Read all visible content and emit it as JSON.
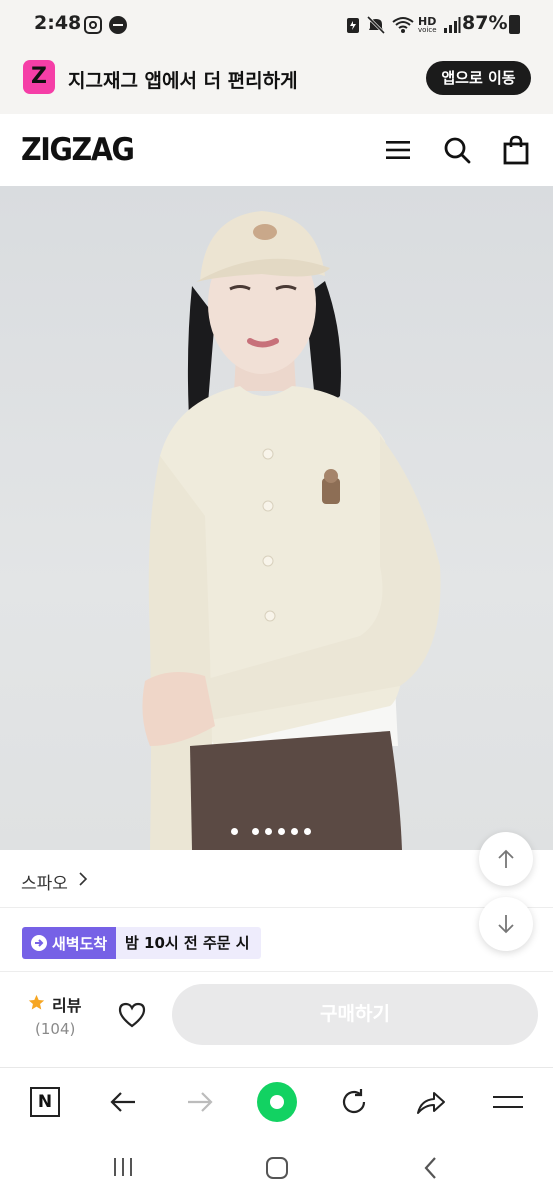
{
  "status_bar": {
    "time": "2:48",
    "network_label": "HD",
    "network_sublabel": "voice",
    "battery_percent": "87%"
  },
  "app_banner": {
    "logo_letter": "Z",
    "message": "지그재그 앱에서 더 편리하게",
    "open_app_button": "앱으로 이동"
  },
  "header": {
    "logo": "ZIGZAG",
    "icons": [
      "menu-icon",
      "search-icon",
      "shopping-bag-icon"
    ]
  },
  "product": {
    "image_count": 6,
    "current_image": 1,
    "brand": "스파오",
    "brand_aux": "°",
    "delivery_badge": "새벽도착",
    "delivery_note": "밤 10시 전 주문 시"
  },
  "action_bar": {
    "review_label": "리뷰",
    "review_count": "(104)",
    "buy_button": "구매하기"
  },
  "colors": {
    "brand_pink": "#f53ea7",
    "dawn_purple": "#7661e6",
    "browser_green": "#12d262",
    "buy_disabled": "#e9e9ea"
  }
}
